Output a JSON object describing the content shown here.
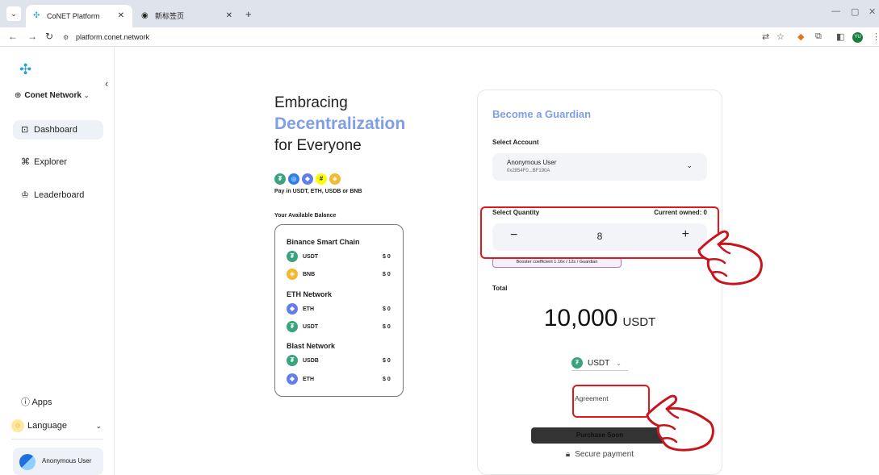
{
  "browser": {
    "tabs": [
      {
        "title": "CoNET Platform",
        "active": true
      },
      {
        "title": "新标签页",
        "active": false
      }
    ],
    "url": "platform.conet.network"
  },
  "sidebar": {
    "network": "Conet Network",
    "nav": [
      {
        "label": "Dashboard",
        "active": true
      },
      {
        "label": "Explorer",
        "active": false
      },
      {
        "label": "Leaderboard",
        "active": false
      }
    ],
    "apps": "Apps",
    "language": "Language",
    "user": "Anonymous User"
  },
  "hero": {
    "line1": "Embracing",
    "line2": "Decentralization",
    "line3": "for Everyone",
    "pay_label": "Pay in USDT, ETH, USDB or BNB",
    "balance_label": "Your Available Balance"
  },
  "balances": [
    {
      "network": "Binance Smart Chain",
      "tokens": [
        {
          "symbol": "USDT",
          "amount": "$ 0",
          "color": "#3aa47f"
        },
        {
          "symbol": "BNB",
          "amount": "$ 0",
          "color": "#f3ba2f"
        }
      ]
    },
    {
      "network": "ETH Network",
      "tokens": [
        {
          "symbol": "ETH",
          "amount": "$ 0",
          "color": "#627eea"
        },
        {
          "symbol": "USDT",
          "amount": "$ 0",
          "color": "#3aa47f"
        }
      ]
    },
    {
      "network": "Blast Network",
      "tokens": [
        {
          "symbol": "USDB",
          "amount": "$ 0",
          "color": "#3aa47f"
        },
        {
          "symbol": "ETH",
          "amount": "$ 0",
          "color": "#627eea"
        }
      ]
    }
  ],
  "guardian": {
    "title": "Become a Guardian",
    "select_account_label": "Select Account",
    "account_name": "Anonymous User",
    "account_address": "0x2854F0...BF190A",
    "select_quantity_label": "Select Quantity",
    "current_owned": "Current owned: 0",
    "minus": "−",
    "quantity": "8",
    "plus": "+",
    "booster": "Booster coefficient 1.16x / 12s / Guardian",
    "total_label": "Total",
    "total_amount": "10,000",
    "total_unit": "USDT",
    "currency": "USDT",
    "agreement": "Agreement",
    "purchase_button": "Purchase Soon",
    "secure_payment": "Secure payment"
  },
  "colors": {
    "accent": "#7f9ee8",
    "highlight": "#e8141c"
  }
}
